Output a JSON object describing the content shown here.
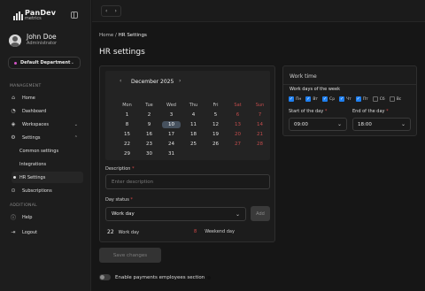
{
  "brand": {
    "name": "PanDev",
    "sub": "metrics"
  },
  "user": {
    "name": "John Doe",
    "role": "Administrator"
  },
  "department": {
    "label": "Default Department",
    "dot_color": "#d455c6"
  },
  "sidebar": {
    "management_label": "MANAGEMENT",
    "additional_label": "ADDITIONAL",
    "items": [
      {
        "label": "Home",
        "icon": "home-icon"
      },
      {
        "label": "Dashboard",
        "icon": "dashboard-icon"
      },
      {
        "label": "Workspaces",
        "icon": "workspaces-icon"
      },
      {
        "label": "Settings",
        "icon": "gear-icon"
      },
      {
        "label": "Common settings"
      },
      {
        "label": "Integrations"
      },
      {
        "label": "HR Settings"
      },
      {
        "label": "Subscriptions",
        "icon": "subscriptions-icon"
      },
      {
        "label": "Help",
        "icon": "help-icon"
      },
      {
        "label": "Logout",
        "icon": "logout-icon"
      }
    ]
  },
  "breadcrumb": {
    "root": "Home",
    "sep": "/",
    "current": "HR Settings"
  },
  "page": {
    "title": "HR settings"
  },
  "calendar": {
    "month": "December 2025",
    "weekdays": [
      "Mon",
      "Tue",
      "Wed",
      "Thu",
      "Fri",
      "Sat",
      "Sun"
    ],
    "weeks": [
      [
        "1",
        "2",
        "3",
        "4",
        "5",
        "6",
        "7"
      ],
      [
        "8",
        "9",
        "10",
        "11",
        "12",
        "13",
        "14"
      ],
      [
        "15",
        "16",
        "17",
        "18",
        "19",
        "20",
        "21"
      ],
      [
        "22",
        "23",
        "24",
        "25",
        "26",
        "27",
        "28"
      ],
      [
        "29",
        "30",
        "31",
        "",
        "",
        "",
        ""
      ]
    ],
    "selected": "10",
    "weekend_color": "#c24b4b",
    "accent_selected": "#46515e"
  },
  "form": {
    "description_label": "Description",
    "description_placeholder": "Enter description",
    "day_status_label": "Day status",
    "day_status_value": "Work day",
    "add_label": "Add",
    "required_mark": "*",
    "work_day_count": "22",
    "work_day_label": "Work day",
    "weekend_count": "8",
    "weekend_label": "Weekend day"
  },
  "actions": {
    "save_label": "Save changes"
  },
  "toggle": {
    "label": "Enable payments employees section",
    "on": false
  },
  "work_time": {
    "title": "Work time",
    "subtitle": "Work days of the week",
    "days": [
      {
        "label": "Пн",
        "checked": true
      },
      {
        "label": "Вт",
        "checked": true
      },
      {
        "label": "Ср",
        "checked": true
      },
      {
        "label": "Чт",
        "checked": true
      },
      {
        "label": "Пт",
        "checked": true
      },
      {
        "label": "Сб",
        "checked": false
      },
      {
        "label": "Вс",
        "checked": false
      }
    ],
    "start_label": "Start of the day",
    "start_value": "09:00",
    "end_label": "End of the day",
    "end_value": "18:00",
    "accent": "#1e7ff0"
  }
}
